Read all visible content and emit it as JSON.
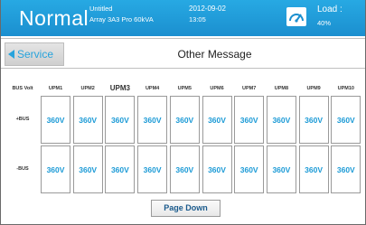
{
  "header": {
    "mode": "Normal",
    "title_line1": "Untitled",
    "title_line2": "Array 3A3 Pro 60kVA",
    "date": "2012-09-02",
    "time": "13:05",
    "load_label": "Load :",
    "load_value": "40%",
    "load_icon": "gauge-icon",
    "accent": "#1f9ad8"
  },
  "nav": {
    "back_label": "Service",
    "page_title": "Other Message"
  },
  "table": {
    "corner_label": "BUS Volt",
    "columns": [
      "UPM1",
      "UPM2",
      "UPM3",
      "UPM4",
      "UPM5",
      "UPM6",
      "UPM7",
      "UPM8",
      "UPM9",
      "UPM10"
    ],
    "rows": [
      {
        "label": "+BUS",
        "values": [
          "360V",
          "360V",
          "360V",
          "360V",
          "360V",
          "360V",
          "360V",
          "360V",
          "360V",
          "360V"
        ]
      },
      {
        "label": "-BUS",
        "values": [
          "360V",
          "360V",
          "360V",
          "360V",
          "360V",
          "360V",
          "360V",
          "360V",
          "360V",
          "360V"
        ]
      }
    ]
  },
  "footer": {
    "page_down_label": "Page Down"
  }
}
